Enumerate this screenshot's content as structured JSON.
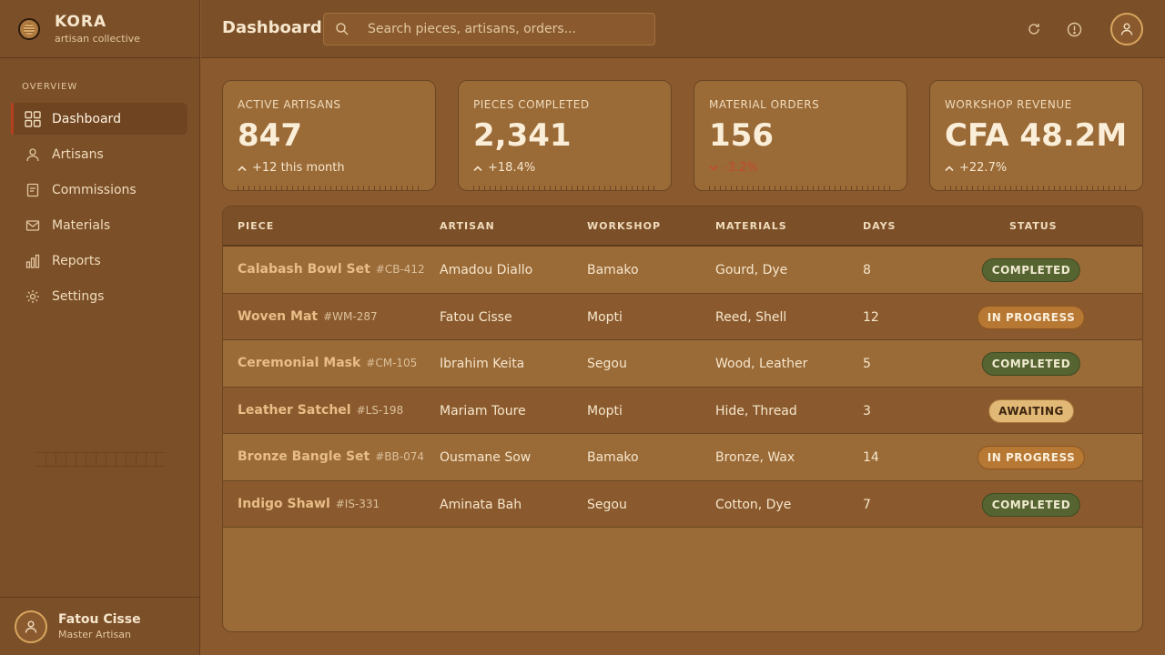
{
  "app": {
    "name": "KORA",
    "tagline": "artisan collective"
  },
  "sidebar": {
    "section_label": "OVERVIEW",
    "items": [
      {
        "label": "Dashboard",
        "icon": "grid-icon",
        "active": true
      },
      {
        "label": "Artisans",
        "icon": "person-icon"
      },
      {
        "label": "Commissions",
        "icon": "document-icon"
      },
      {
        "label": "Materials",
        "icon": "envelope-icon"
      },
      {
        "label": "Reports",
        "icon": "bar-chart-icon"
      },
      {
        "label": "Settings",
        "icon": "gear-icon"
      }
    ]
  },
  "user": {
    "name": "Fatou Cisse",
    "role": "Master Artisan"
  },
  "header": {
    "title": "Dashboard",
    "search_placeholder": "Search pieces, artisans, orders..."
  },
  "kpis": [
    {
      "label": "ACTIVE ARTISANS",
      "value": "847",
      "delta": "+12 this month",
      "trend": "up"
    },
    {
      "label": "PIECES COMPLETED",
      "value": "2,341",
      "delta": "+18.4%",
      "trend": "up"
    },
    {
      "label": "MATERIAL ORDERS",
      "value": "156",
      "delta": "-3.2%",
      "trend": "down"
    },
    {
      "label": "WORKSHOP REVENUE",
      "value": "CFA 48.2M",
      "delta": "+22.7%",
      "trend": "up"
    }
  ],
  "table": {
    "columns": [
      "PIECE",
      "ARTISAN",
      "WORKSHOP",
      "MATERIALS",
      "DAYS",
      "STATUS"
    ],
    "rows": [
      {
        "piece": "Calabash Bowl Set",
        "code": "#CB-412",
        "artisan": "Amadou Diallo",
        "workshop": "Bamako",
        "materials": "Gourd, Dye",
        "days": "8",
        "status": "COMPLETED"
      },
      {
        "piece": "Woven Mat",
        "code": "#WM-287",
        "artisan": "Fatou Cisse",
        "workshop": "Mopti",
        "materials": "Reed, Shell",
        "days": "12",
        "status": "IN PROGRESS"
      },
      {
        "piece": "Ceremonial Mask",
        "code": "#CM-105",
        "artisan": "Ibrahim Keita",
        "workshop": "Segou",
        "materials": "Wood, Leather",
        "days": "5",
        "status": "COMPLETED"
      },
      {
        "piece": "Leather Satchel",
        "code": "#LS-198",
        "artisan": "Mariam Toure",
        "workshop": "Mopti",
        "materials": "Hide, Thread",
        "days": "3",
        "status": "AWAITING"
      },
      {
        "piece": "Bronze Bangle Set",
        "code": "#BB-074",
        "artisan": "Ousmane Sow",
        "workshop": "Bamako",
        "materials": "Bronze, Wax",
        "days": "14",
        "status": "IN PROGRESS"
      },
      {
        "piece": "Indigo Shawl",
        "code": "#IS-331",
        "artisan": "Aminata Bah",
        "workshop": "Segou",
        "materials": "Cotton, Dye",
        "days": "7",
        "status": "COMPLETED"
      }
    ]
  },
  "colors": {
    "background": "#8a5a2e",
    "sidebar": "#7b4f28",
    "accent": "#b3401f",
    "completed": "#566431",
    "in_progress": "#b77834",
    "awaiting": "#e2b876",
    "negative": "#c54a2b"
  }
}
